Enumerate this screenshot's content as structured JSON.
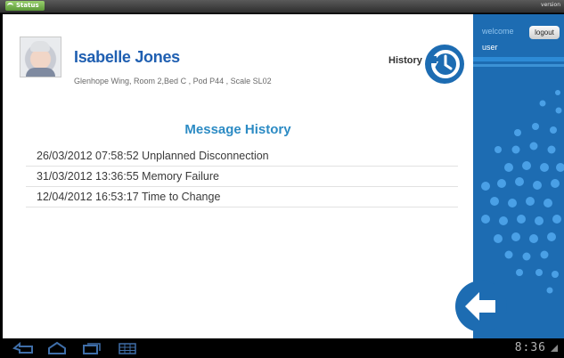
{
  "status_bar": {
    "app_tag": "Status",
    "version_text": "version"
  },
  "patient": {
    "name": "Isabelle Jones",
    "location": "Glenhope Wing, Room 2,Bed C , Pod P44 , Scale SL02"
  },
  "history_button": {
    "label": "History",
    "icon": "history-clock-icon"
  },
  "message_history": {
    "title": "Message History",
    "entries": [
      "26/03/2012 07:58:52 Unplanned Disconnection",
      "31/03/2012 13:36:55 Memory Failure",
      "12/04/2012 16:53:17 Time to Change"
    ]
  },
  "sidebar": {
    "welcome_label": "welcome",
    "username": "user",
    "logout_label": "logout",
    "back_icon": "back-arrow-icon"
  },
  "nav_bar": {
    "icons": [
      "back-icon",
      "home-icon",
      "recent-apps-icon",
      "menu-icon"
    ],
    "clock": "8:36"
  },
  "colors": {
    "brand_blue": "#1d6cb2",
    "name_blue": "#1f5fb1",
    "title_blue": "#2c8bc4"
  }
}
